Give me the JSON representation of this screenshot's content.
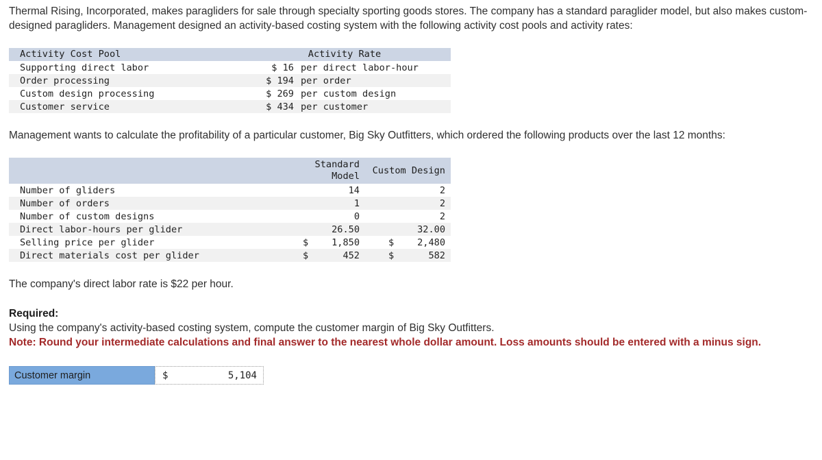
{
  "intro": {
    "paragraph": "Thermal Rising, Incorporated, makes paragliders for sale through specialty sporting goods stores. The company has a standard paraglider model, but also makes custom-designed paragliders. Management designed an activity-based costing system with the following activity cost pools and activity rates:"
  },
  "activity_table": {
    "headers": {
      "pool": "Activity Cost Pool",
      "rate": "Activity Rate"
    },
    "rows": [
      {
        "pool": "Supporting direct labor",
        "symbol": "$",
        "amount": "16",
        "unit": "per direct labor-hour"
      },
      {
        "pool": "Order processing",
        "symbol": "$",
        "amount": "194",
        "unit": "per order"
      },
      {
        "pool": "Custom design processing",
        "symbol": "$",
        "amount": "269",
        "unit": "per custom design"
      },
      {
        "pool": "Customer service",
        "symbol": "$",
        "amount": "434",
        "unit": "per customer"
      }
    ]
  },
  "mid_paragraph": {
    "text": "Management wants to calculate the profitability of a particular customer, Big Sky Outfitters, which ordered the following products over the last 12 months:"
  },
  "orders_table": {
    "headers": {
      "blank": "",
      "standard_line1": "Standard",
      "standard_line2": "Model",
      "custom": "Custom Design"
    },
    "rows": [
      {
        "label": "Number of gliders",
        "std_symbol": "",
        "std_value": "14",
        "cus_symbol": "",
        "cus_value": "2"
      },
      {
        "label": "Number of orders",
        "std_symbol": "",
        "std_value": "1",
        "cus_symbol": "",
        "cus_value": "2"
      },
      {
        "label": "Number of custom designs",
        "std_symbol": "",
        "std_value": "0",
        "cus_symbol": "",
        "cus_value": "2"
      },
      {
        "label": "Direct labor-hours per glider",
        "std_symbol": "",
        "std_value": "26.50",
        "cus_symbol": "",
        "cus_value": "32.00"
      },
      {
        "label": "Selling price per glider",
        "std_symbol": "$",
        "std_value": "1,850",
        "cus_symbol": "$",
        "cus_value": "2,480"
      },
      {
        "label": "Direct materials cost per glider",
        "std_symbol": "$",
        "std_value": "452",
        "cus_symbol": "$",
        "cus_value": "582"
      }
    ]
  },
  "labor_rate": {
    "text": "The company's direct labor rate is $22 per hour."
  },
  "required": {
    "heading": "Required:",
    "instruction": "Using the company's activity-based costing system, compute the customer margin of Big Sky Outfitters.",
    "note": "Note: Round your intermediate calculations and final answer to the nearest whole dollar amount. Loss amounts should be entered with a minus sign.",
    "note_color": "#a32a2a"
  },
  "answer": {
    "label": "Customer margin",
    "currency_symbol": "$",
    "value": "5,104",
    "label_bg": "#7aa9dd"
  }
}
